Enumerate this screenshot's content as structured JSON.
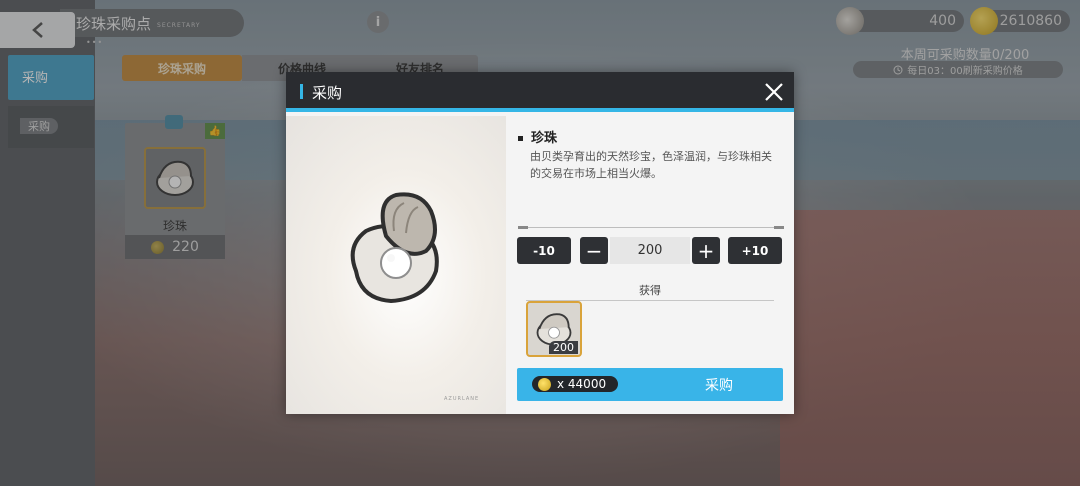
{
  "header": {
    "back_icon": "chevron-left-icon",
    "title": "珍珠采购点",
    "title_sub": "SECRETARY",
    "info_icon": "info-icon",
    "pearl_count": "400",
    "coin_count": "2610860",
    "weekly_limit": "本周可采购数量0/200",
    "refresh_note": "每日03：00刷新采购价格"
  },
  "sidebar": {
    "items": [
      {
        "label": "采购"
      },
      {
        "label": "采购"
      }
    ]
  },
  "tabs": [
    {
      "label": "珍珠采购",
      "active": true
    },
    {
      "label": "价格曲线",
      "active": false
    },
    {
      "label": "好友排名",
      "active": false
    }
  ],
  "shop_item": {
    "name": "珍珠",
    "price": "220"
  },
  "modal": {
    "title": "采购",
    "close_icon": "close-icon",
    "item_name": "珍珠",
    "item_desc": "由贝类孕育出的天然珍宝，色泽温润，与珍珠相关的交易在市场上相当火爆。",
    "art_footer": "AZURLANE",
    "minus10_label": "-10",
    "minus1_label": "−",
    "quantity": "200",
    "plus1_label": "+",
    "plus10_label": "+10",
    "obtain_label": "获得",
    "reward_count": "200",
    "cost": "x 44000",
    "buy_label": "采购"
  },
  "colors": {
    "accent_blue": "#35b6e6",
    "tab_active": "#c48b3c",
    "modal_header": "#2a2c30",
    "reward_border": "#d9a33a"
  }
}
